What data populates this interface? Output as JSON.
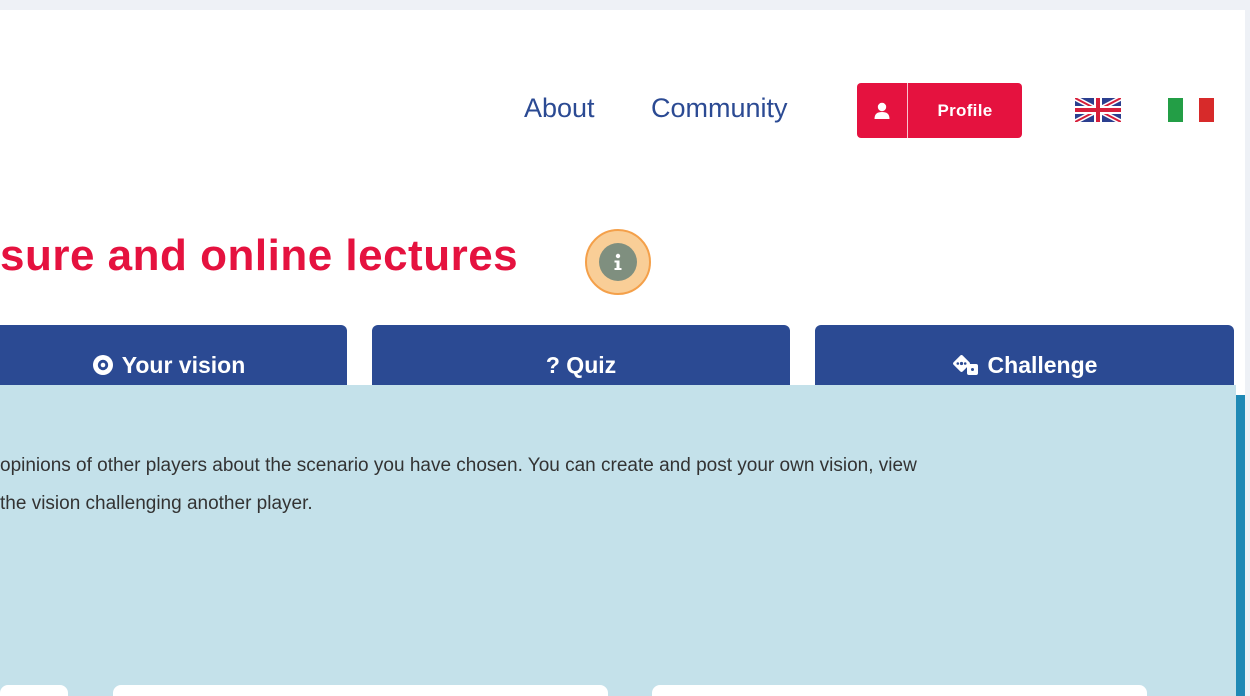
{
  "header": {
    "nav": [
      {
        "label": "About"
      },
      {
        "label": "Community"
      }
    ],
    "profile_label": "Profile",
    "profile_icon": "user-icon",
    "flags": [
      "uk-flag-icon",
      "italy-flag-icon"
    ]
  },
  "title": "sure and online lectures",
  "info_icon": "info-icon",
  "tabs": [
    {
      "label": "Your vision",
      "icon": "eye-icon"
    },
    {
      "label": "? Quiz",
      "icon": ""
    },
    {
      "label": "Challenge",
      "icon": "dice-icon"
    }
  ],
  "panel": {
    "line1": "opinions of other players about the scenario you have chosen. You can create and post your own vision, view",
    "line2": "the vision challenging another player."
  },
  "colors": {
    "brand_red": "#e5123f",
    "brand_blue": "#2b4a93",
    "panel_bg": "#c4e1ea",
    "panel_edge": "#1f89b5",
    "info_ring": "#f4a04a"
  }
}
